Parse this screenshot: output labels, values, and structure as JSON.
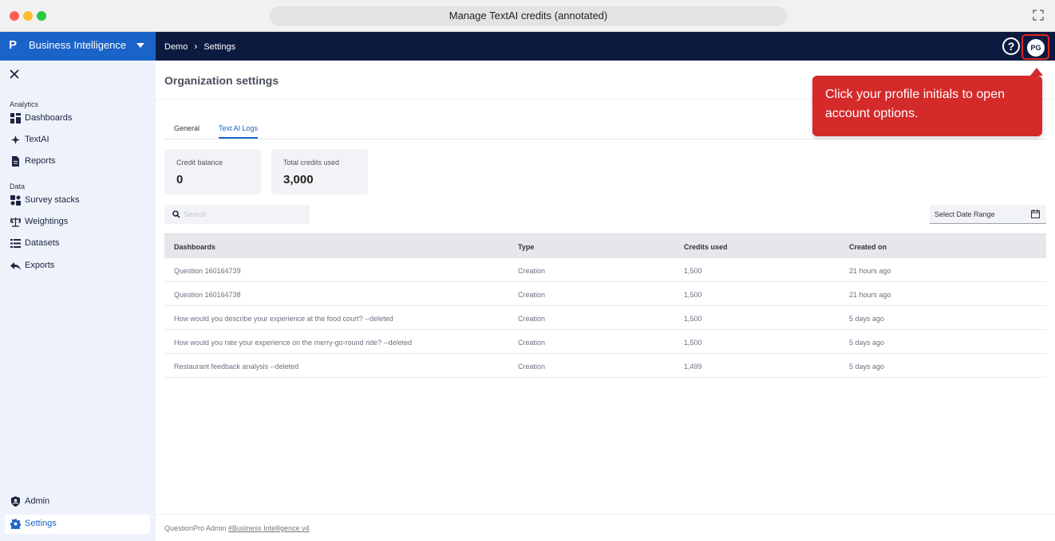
{
  "window": {
    "title": "Manage TextAI credits (annotated)"
  },
  "appbar": {
    "brand_logo": "P",
    "brand_label": "Business Intelligence",
    "breadcrumb": [
      "Demo",
      "Settings"
    ],
    "help": "?",
    "avatar_initials": "PG"
  },
  "sidebar": {
    "sections": {
      "analytics": "Analytics",
      "data": "Data"
    },
    "analytics_items": [
      {
        "label": "Dashboards",
        "icon": "dashboard-icon"
      },
      {
        "label": "TextAI",
        "icon": "sparkle-icon"
      },
      {
        "label": "Reports",
        "icon": "report-icon"
      }
    ],
    "data_items": [
      {
        "label": "Survey stacks",
        "icon": "stack-icon"
      },
      {
        "label": "Weightings",
        "icon": "scale-icon"
      },
      {
        "label": "Datasets",
        "icon": "list-icon"
      },
      {
        "label": "Exports",
        "icon": "export-icon"
      }
    ],
    "bottom_items": [
      {
        "label": "Admin",
        "icon": "shield-icon"
      },
      {
        "label": "Settings",
        "icon": "gear-icon",
        "active": true
      }
    ]
  },
  "main": {
    "title": "Organization settings",
    "tabs": [
      "General",
      "Text AI Logs"
    ],
    "active_tab": "Text AI Logs",
    "cards": [
      {
        "label": "Credit balance",
        "value": "0"
      },
      {
        "label": "Total credits used",
        "value": "3,000"
      }
    ],
    "search_placeholder": "Search",
    "date_range_label": "Select Date Range",
    "table": {
      "columns": [
        "Dashboards",
        "Type",
        "Credits used",
        "Created on"
      ],
      "rows": [
        [
          "Question 160164739",
          "Creation",
          "1,500",
          "21 hours ago"
        ],
        [
          "Question 160164738",
          "Creation",
          "1,500",
          "21 hours ago"
        ],
        [
          "How would you describe your experience at the food court? --deleted",
          "Creation",
          "1,500",
          "5 days ago"
        ],
        [
          "How would you rate your experience on the merry-go-round ride? --deleted",
          "Creation",
          "1,500",
          "5 days ago"
        ],
        [
          "Restaurant feedback analysis --deleted",
          "Creation",
          "1,499",
          "5 days ago"
        ]
      ]
    },
    "footer": {
      "text": "QuestionPro Admin ",
      "link": "#Business Intelligence v4"
    }
  },
  "annotation": {
    "text": "Click your profile initials to open account options."
  },
  "colors": {
    "brand": "#1a63c9",
    "appbar": "#0d1a3f",
    "callout": "#d42a2a",
    "sidebar": "#eef2fb"
  }
}
